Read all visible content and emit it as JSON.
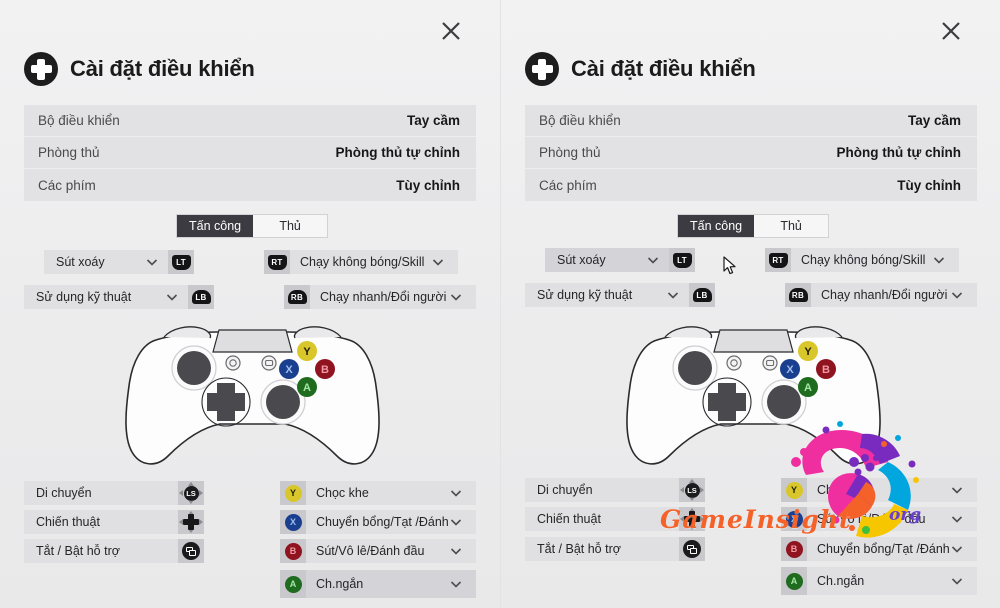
{
  "window": {
    "close_label": "×",
    "close_icon": "close-icon",
    "title": "Cài đặt điều khiển",
    "logo_icon": "dpad-logo-icon"
  },
  "info_table": {
    "rows": [
      {
        "label": "Bộ điều khiển",
        "value": "Tay cầm"
      },
      {
        "label": "Phòng thủ",
        "value": "Phòng thủ tự chỉnh"
      },
      {
        "label": "Các phím",
        "value": "Tùy chỉnh"
      }
    ]
  },
  "tabs": [
    {
      "label": "Tấn công",
      "active": true
    },
    {
      "label": "Thủ",
      "active": false
    }
  ],
  "triggers": {
    "lt": {
      "label": "Sút xoáy",
      "badge": "LT",
      "badge_icon": "left-trigger-icon"
    },
    "rt": {
      "label": "Chạy không bóng/Skill",
      "badge": "RT",
      "badge_icon": "right-trigger-icon"
    },
    "lb": {
      "label": "Sử dụng kỹ thuật",
      "badge": "LB",
      "badge_icon": "left-bumper-icon"
    },
    "rb": {
      "label": "Chạy nhanh/Đổi người đá",
      "badge": "RB",
      "badge_icon": "right-bumper-icon"
    }
  },
  "left_controls": [
    {
      "label": "Di chuyển",
      "badge_icon": "left-stick-icon",
      "badge": "LS"
    },
    {
      "label": "Chiến thuật",
      "badge_icon": "dpad-icon",
      "badge": ""
    },
    {
      "label": "Tắt / Bật hỗ trợ",
      "badge_icon": "view-button-icon",
      "badge": ""
    }
  ],
  "face_controls_left": [
    {
      "button": "Y",
      "label": "Chọc khe",
      "color": "#d8c62a",
      "text_color": "#1d1d0a",
      "highlight": false
    },
    {
      "button": "X",
      "label": "Chuyển bổng/Tạt /Đánh d",
      "color": "#1b3f8f",
      "text_color": "#9fc0ef",
      "highlight": false
    },
    {
      "button": "B",
      "label": "Sút/Vô lê/Đánh đầu",
      "color": "#8f1420",
      "text_color": "#f09aa2",
      "highlight": false
    },
    {
      "button": "A",
      "label": "Ch.ngắn",
      "color": "#1f6b1f",
      "text_color": "#a5e6a5",
      "highlight": true
    }
  ],
  "face_controls_right": [
    {
      "button": "Y",
      "label": "Chọc khe",
      "color": "#d8c62a",
      "text_color": "#1d1d0a",
      "highlight": false
    },
    {
      "button": "X",
      "label": "Sút/Vô lê/Đánh đầu",
      "color": "#1b3f8f",
      "text_color": "#9fc0ef",
      "highlight": false
    },
    {
      "button": "B",
      "label": "Chuyển bổng/Tạt /Đánh d",
      "color": "#8f1420",
      "text_color": "#f09aa2",
      "highlight": false
    },
    {
      "button": "A",
      "label": "Ch.ngắn",
      "color": "#1f6b1f",
      "text_color": "#a5e6a5",
      "highlight": false
    }
  ],
  "watermark": {
    "text": "GameInsight",
    "tld": "org"
  },
  "colors": {
    "background": "#ececed",
    "row_bg": "#e0e0e3",
    "tab_active": "#3b3b41",
    "accent_orange": "#f4622a",
    "accent_purple": "#6a3fd0"
  }
}
